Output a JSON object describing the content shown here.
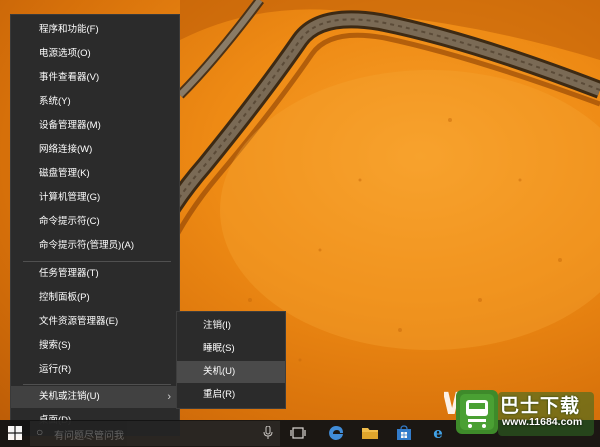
{
  "context_menu": {
    "items": [
      {
        "label": "程序和功能(F)"
      },
      {
        "label": "电源选项(O)"
      },
      {
        "label": "事件查看器(V)"
      },
      {
        "label": "系统(Y)"
      },
      {
        "label": "设备管理器(M)"
      },
      {
        "label": "网络连接(W)"
      },
      {
        "label": "磁盘管理(K)"
      },
      {
        "label": "计算机管理(G)"
      },
      {
        "label": "命令提示符(C)"
      },
      {
        "label": "命令提示符(管理员)(A)"
      },
      {
        "label": "任务管理器(T)"
      },
      {
        "label": "控制面板(P)"
      },
      {
        "label": "文件资源管理器(E)"
      },
      {
        "label": "搜索(S)"
      },
      {
        "label": "运行(R)"
      },
      {
        "label": "关机或注销(U)"
      },
      {
        "label": "桌面(D)"
      }
    ]
  },
  "submenu": {
    "items": [
      {
        "label": "注销(I)"
      },
      {
        "label": "睡眠(S)"
      },
      {
        "label": "关机(U)"
      },
      {
        "label": "重启(R)"
      }
    ]
  },
  "taskbar": {
    "search_placeholder": "有问题尽管问我",
    "icons": [
      "windows-start-icon",
      "microphone-icon",
      "task-view-icon",
      "edge-icon",
      "file-explorer-icon",
      "store-icon",
      "ie-icon"
    ]
  },
  "watermark": {
    "title": "巴士下载",
    "url": "www.11684.com"
  },
  "colors": {
    "menu_bg": "#2b2b2b",
    "menu_hover": "#414141",
    "wallpaper": "#ee8a14",
    "watermark_green": "#3e8a2a"
  }
}
